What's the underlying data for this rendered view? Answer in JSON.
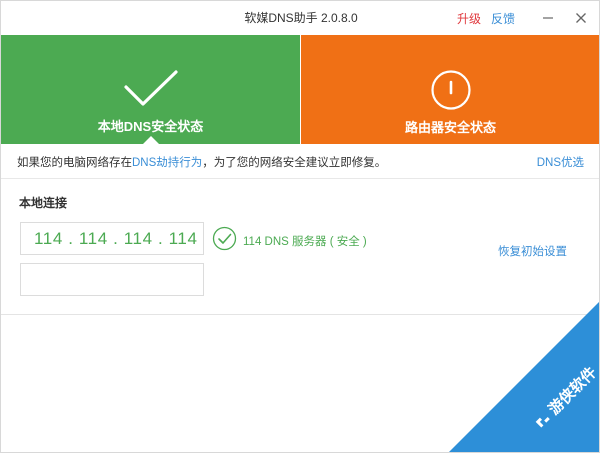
{
  "window": {
    "title": "软媒DNS助手 2.0.8.0",
    "upgrade_label": "升级",
    "feedback_label": "反馈"
  },
  "panels": {
    "local": {
      "label": "本地DNS安全状态",
      "color": "#4caa52",
      "icon": "checkmark-icon"
    },
    "router": {
      "label": "路由器安全状态",
      "color": "#f07015",
      "icon": "power-icon"
    }
  },
  "notice": {
    "text_before": "如果您的电脑网络存在",
    "link_text": "DNS劫持行为",
    "text_after": "，为了您的网络安全建议立即修复。",
    "dns_optimize_label": "DNS优选"
  },
  "local_connection": {
    "title": "本地连接",
    "primary_dns": "114 . 114 . 114 . 114",
    "secondary_dns": "",
    "server_status": "114 DNS 服务器 ( 安全 )",
    "restore_label": "恢复初始设置"
  },
  "watermark": {
    "text": "游侠软件",
    "color": "#2d8fd8"
  }
}
